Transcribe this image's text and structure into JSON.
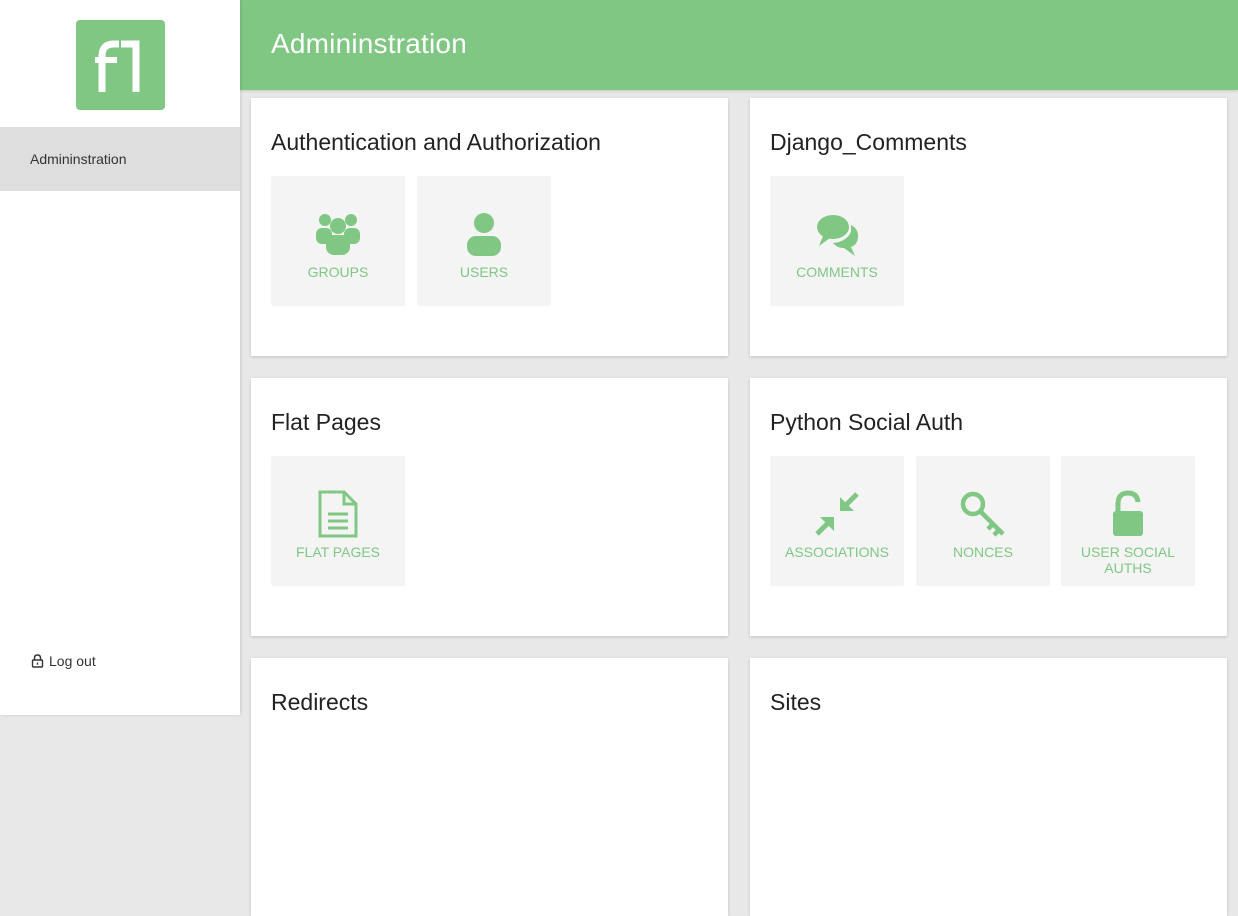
{
  "sidebar": {
    "logo_text": "fl",
    "nav_item": "Admininstration",
    "logout": "Log out"
  },
  "header": {
    "title": "Admininstration"
  },
  "colors": {
    "accent": "#7fc783",
    "tile_bg": "#f4f4f4",
    "nav_active": "#dedede"
  },
  "cards": [
    {
      "title": "Authentication and Authorization",
      "tiles": [
        {
          "label": "Groups",
          "icon": "groups-icon"
        },
        {
          "label": "Users",
          "icon": "user-icon"
        }
      ]
    },
    {
      "title": "Django_Comments",
      "tiles": [
        {
          "label": "Comments",
          "icon": "comments-icon"
        }
      ]
    },
    {
      "title": "Flat Pages",
      "tiles": [
        {
          "label": "Flat pages",
          "icon": "document-icon"
        }
      ]
    },
    {
      "title": "Python Social Auth",
      "tiles": [
        {
          "label": "Associations",
          "icon": "compress-icon"
        },
        {
          "label": "Nonces",
          "icon": "key-icon"
        },
        {
          "label": "User social auths",
          "icon": "unlock-icon"
        }
      ]
    },
    {
      "title": "Redirects",
      "tiles": []
    },
    {
      "title": "Sites",
      "tiles": []
    }
  ]
}
